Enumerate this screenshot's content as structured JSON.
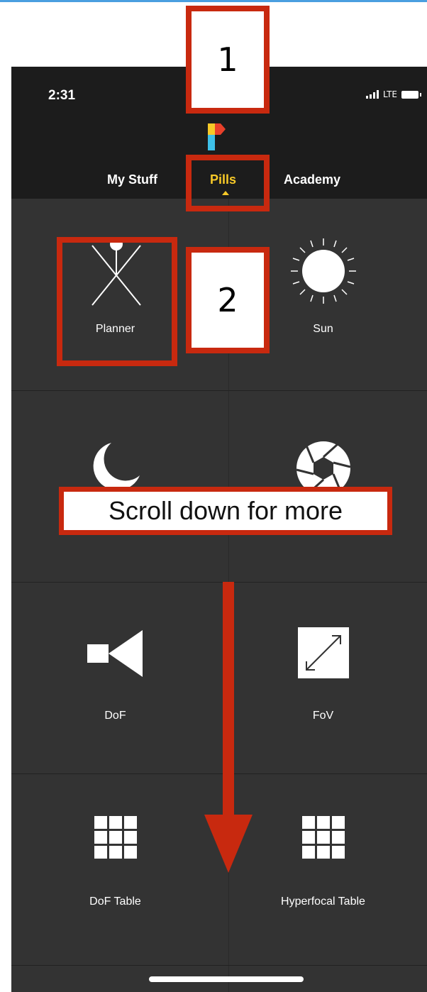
{
  "status_bar": {
    "time": "2:31",
    "network": "LTE"
  },
  "tabs": [
    {
      "label": "My Stuff"
    },
    {
      "label": "Pills"
    },
    {
      "label": "Academy"
    }
  ],
  "active_tab": "Pills",
  "pills": [
    {
      "label": "Planner",
      "icon": "planner-icon"
    },
    {
      "label": "Sun",
      "icon": "sun-icon"
    },
    {
      "label": "Moon",
      "icon": "moon-icon"
    },
    {
      "label": "Exposure",
      "icon": "aperture-icon"
    },
    {
      "label": "DoF",
      "icon": "dof-icon"
    },
    {
      "label": "FoV",
      "icon": "fov-icon"
    },
    {
      "label": "DoF Table",
      "icon": "grid-icon"
    },
    {
      "label": "Hyperfocal Table",
      "icon": "grid-icon"
    }
  ],
  "annotations": {
    "marker_1": "1",
    "marker_2": "2",
    "scroll_note": "Scroll down for more"
  },
  "colors": {
    "accent": "#f7c928",
    "annotation": "#c8290f",
    "background": "#333333",
    "header": "#1c1c1c"
  }
}
